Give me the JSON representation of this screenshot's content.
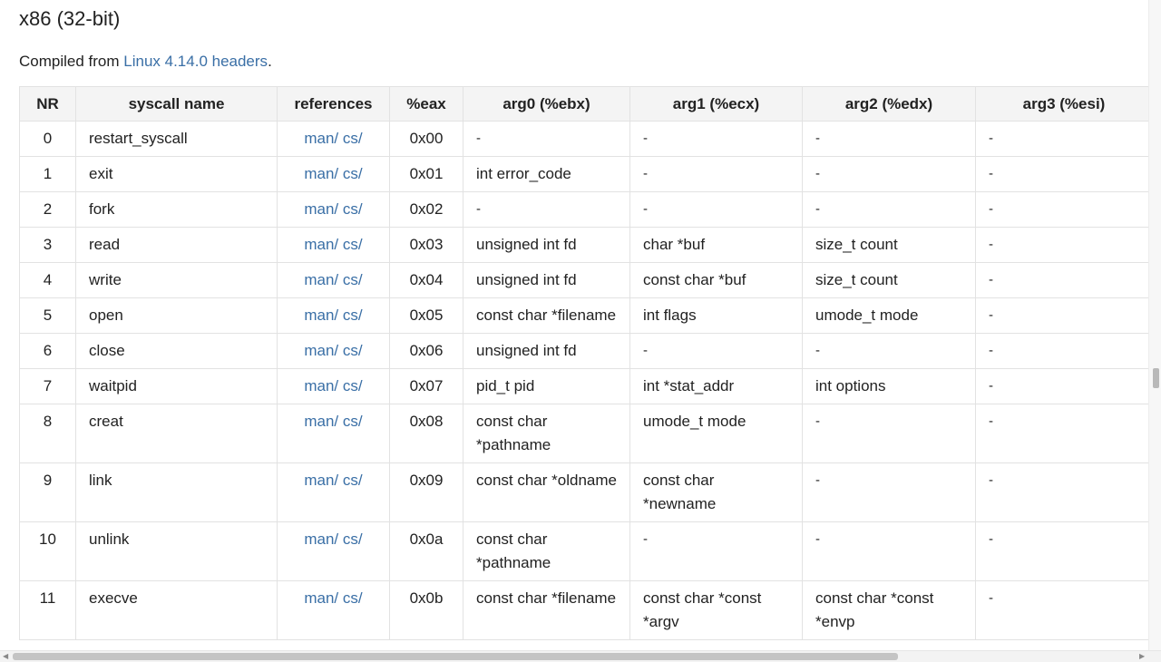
{
  "heading": "x86 (32-bit)",
  "intro": {
    "prefix": "Compiled from ",
    "link": "Linux 4.14.0 headers",
    "suffix": "."
  },
  "table": {
    "columns": [
      "NR",
      "syscall name",
      "references",
      "%eax",
      "arg0 (%ebx)",
      "arg1 (%ecx)",
      "arg2 (%edx)",
      "arg3 (%esi)"
    ],
    "rows": [
      {
        "nr": "0",
        "name": "restart_syscall",
        "man": "man/",
        "cs": "cs/",
        "eax": "0x00",
        "arg0": "-",
        "arg1": "-",
        "arg2": "-",
        "arg3": "-"
      },
      {
        "nr": "1",
        "name": "exit",
        "man": "man/",
        "cs": "cs/",
        "eax": "0x01",
        "arg0": "int error_code",
        "arg1": "-",
        "arg2": "-",
        "arg3": "-"
      },
      {
        "nr": "2",
        "name": "fork",
        "man": "man/",
        "cs": "cs/",
        "eax": "0x02",
        "arg0": "-",
        "arg1": "-",
        "arg2": "-",
        "arg3": "-"
      },
      {
        "nr": "3",
        "name": "read",
        "man": "man/",
        "cs": "cs/",
        "eax": "0x03",
        "arg0": "unsigned int fd",
        "arg1": "char *buf",
        "arg2": "size_t count",
        "arg3": "-"
      },
      {
        "nr": "4",
        "name": "write",
        "man": "man/",
        "cs": "cs/",
        "eax": "0x04",
        "arg0": "unsigned int fd",
        "arg1": "const char *buf",
        "arg2": "size_t count",
        "arg3": "-"
      },
      {
        "nr": "5",
        "name": "open",
        "man": "man/",
        "cs": "cs/",
        "eax": "0x05",
        "arg0": "const char *filename",
        "arg1": "int flags",
        "arg2": "umode_t mode",
        "arg3": "-"
      },
      {
        "nr": "6",
        "name": "close",
        "man": "man/",
        "cs": "cs/",
        "eax": "0x06",
        "arg0": "unsigned int fd",
        "arg1": "-",
        "arg2": "-",
        "arg3": "-"
      },
      {
        "nr": "7",
        "name": "waitpid",
        "man": "man/",
        "cs": "cs/",
        "eax": "0x07",
        "arg0": "pid_t pid",
        "arg1": "int *stat_addr",
        "arg2": "int options",
        "arg3": "-"
      },
      {
        "nr": "8",
        "name": "creat",
        "man": "man/",
        "cs": "cs/",
        "eax": "0x08",
        "arg0": "const char *pathname",
        "arg1": "umode_t mode",
        "arg2": "-",
        "arg3": "-"
      },
      {
        "nr": "9",
        "name": "link",
        "man": "man/",
        "cs": "cs/",
        "eax": "0x09",
        "arg0": "const char *oldname",
        "arg1": "const char *newname",
        "arg2": "-",
        "arg3": "-"
      },
      {
        "nr": "10",
        "name": "unlink",
        "man": "man/",
        "cs": "cs/",
        "eax": "0x0a",
        "arg0": "const char *pathname",
        "arg1": "-",
        "arg2": "-",
        "arg3": "-"
      },
      {
        "nr": "11",
        "name": "execve",
        "man": "man/",
        "cs": "cs/",
        "eax": "0x0b",
        "arg0": "const char *filename",
        "arg1": "const char *const *argv",
        "arg2": "const char *const *envp",
        "arg3": "-"
      }
    ]
  },
  "colors": {
    "link": "#3a6fa6",
    "header_bg": "#f4f4f4",
    "border": "#e2e2e2"
  }
}
